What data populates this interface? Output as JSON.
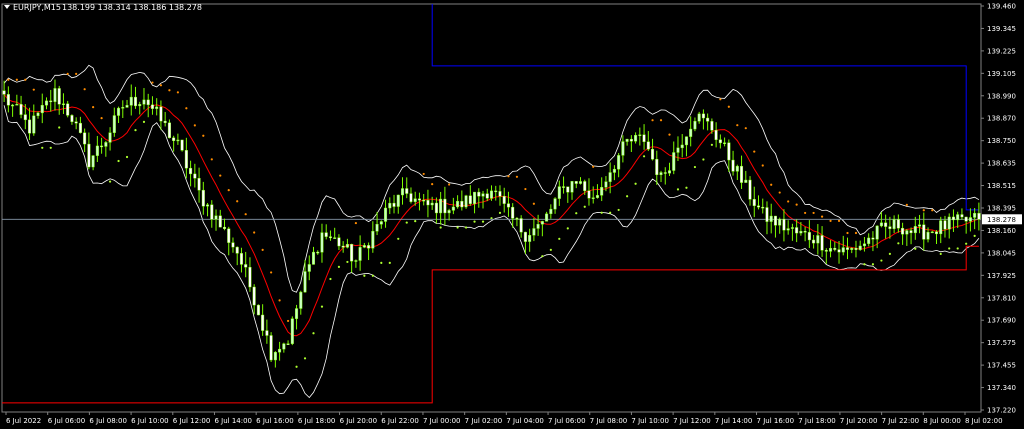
{
  "header": {
    "symbol": "EURJPY,M15",
    "ohlc": "138.199 138.314 138.186 138.278",
    "menu_icon": "triangle-down-icon"
  },
  "colors": {
    "background": "#000000",
    "bull_candle": "#c8ffc0",
    "bear_candle": "#ffffff",
    "wick": "#7fff00",
    "ma_red": "#ff0000",
    "bands_white": "#ffffff",
    "psar_orange": "#ff8c00",
    "psar_green": "#adff2f",
    "channel_blue": "#0000ff",
    "channel_red": "#ff0000",
    "price_line": "#8899aa",
    "price_box": "#ffffff"
  },
  "chart_data": {
    "type": "candlestick",
    "symbol": "EURJPY",
    "timeframe": "M15",
    "current_price": "138.278",
    "ylim": [
      137.22,
      139.46
    ],
    "y_ticks": [
      "139.460",
      "139.345",
      "139.225",
      "139.105",
      "138.990",
      "138.870",
      "138.750",
      "138.635",
      "138.515",
      "138.395",
      "138.160",
      "138.045",
      "137.925",
      "137.810",
      "137.690",
      "137.575",
      "137.455",
      "137.340",
      "137.220"
    ],
    "x_ticks": [
      "6 Jul 2022",
      "6 Jul 06:00",
      "6 Jul 08:00",
      "6 Jul 10:00",
      "6 Jul 12:00",
      "6 Jul 14:00",
      "6 Jul 16:00",
      "6 Jul 18:00",
      "6 Jul 20:00",
      "6 Jul 22:00",
      "7 Jul 00:00",
      "7 Jul 02:00",
      "7 Jul 04:00",
      "7 Jul 06:00",
      "7 Jul 08:00",
      "7 Jul 10:00",
      "7 Jul 12:00",
      "7 Jul 14:00",
      "7 Jul 16:00",
      "7 Jul 18:00",
      "7 Jul 20:00",
      "7 Jul 22:00",
      "8 Jul 00:00",
      "8 Jul 02:00"
    ],
    "close_anchors": [
      [
        0,
        138.95
      ],
      [
        6,
        138.78
      ],
      [
        12,
        138.97
      ],
      [
        16,
        138.84
      ],
      [
        20,
        138.6
      ],
      [
        24,
        138.72
      ],
      [
        28,
        138.9
      ],
      [
        33,
        138.95
      ],
      [
        37,
        138.82
      ],
      [
        41,
        138.68
      ],
      [
        46,
        138.42
      ],
      [
        50,
        138.28
      ],
      [
        55,
        138.1
      ],
      [
        59,
        137.85
      ],
      [
        63,
        137.55
      ],
      [
        67,
        137.62
      ],
      [
        71,
        137.96
      ],
      [
        75,
        138.2
      ],
      [
        79,
        138.15
      ],
      [
        83,
        138.05
      ],
      [
        87,
        138.2
      ],
      [
        91,
        138.35
      ],
      [
        95,
        138.42
      ],
      [
        99,
        138.35
      ],
      [
        103,
        138.35
      ],
      [
        107,
        138.35
      ],
      [
        111,
        138.4
      ],
      [
        115,
        138.45
      ],
      [
        119,
        138.3
      ],
      [
        123,
        138.2
      ],
      [
        127,
        138.25
      ],
      [
        131,
        138.42
      ],
      [
        135,
        138.5
      ],
      [
        139,
        138.38
      ],
      [
        143,
        138.55
      ],
      [
        147,
        138.7
      ],
      [
        151,
        138.72
      ],
      [
        155,
        138.5
      ],
      [
        159,
        138.68
      ],
      [
        163,
        138.85
      ],
      [
        167,
        138.78
      ],
      [
        171,
        138.62
      ],
      [
        175,
        138.45
      ],
      [
        179,
        138.3
      ],
      [
        183,
        138.25
      ],
      [
        187,
        138.2
      ],
      [
        191,
        138.18
      ],
      [
        195,
        138.12
      ],
      [
        199,
        138.1
      ],
      [
        203,
        138.15
      ],
      [
        207,
        138.22
      ],
      [
        211,
        138.25
      ],
      [
        215,
        138.2
      ],
      [
        219,
        138.22
      ],
      [
        223,
        138.25
      ],
      [
        227,
        138.27
      ],
      [
        230,
        138.278
      ]
    ],
    "candle_count": 231
  }
}
